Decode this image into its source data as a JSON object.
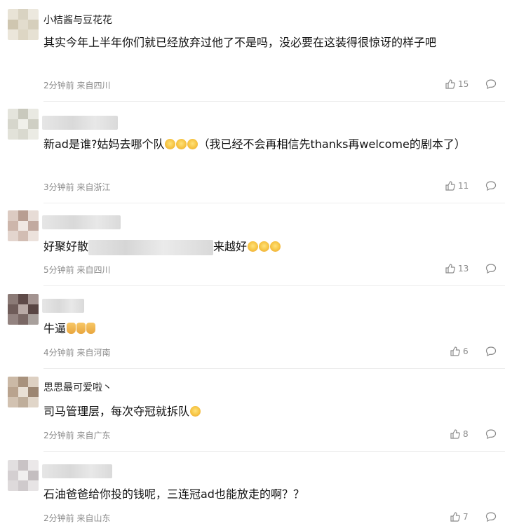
{
  "comments": [
    {
      "username": "小桔酱与豆花花",
      "name_hidden": false,
      "text": "其实今年上半年你们就已经放弃过他了不是吗，没必要在这装得很惊讶的样子吧",
      "meta": "2分钟前 来自四川",
      "likes": "15"
    },
    {
      "username": "",
      "name_hidden": true,
      "text_before": "新ad是谁?姑妈去哪个队",
      "text_after": "（我已经不会再相信先thanks再welcome的剧本了）",
      "meta": "3分钟前 来自浙江",
      "likes": "11"
    },
    {
      "username": "",
      "name_hidden": true,
      "text_before": "好聚好散",
      "text_after": "来越好",
      "meta": "5分钟前 来自四川",
      "likes": "13"
    },
    {
      "username": "",
      "name_hidden": true,
      "text": "牛逼",
      "meta": "4分钟前 来自河南",
      "likes": "6"
    },
    {
      "username": "思思最可爱啦丶",
      "name_hidden": false,
      "text": "司马管理层，每次夺冠就拆队",
      "meta": "2分钟前 来自广东",
      "likes": "8"
    },
    {
      "username": "",
      "name_hidden": true,
      "text": "石油爸爸给你投的钱呢，三连冠ad也能放走的啊？？",
      "meta": "2分钟前 来自山东",
      "likes": "7"
    }
  ],
  "colors": {
    "meta": "#8a8a8a",
    "text": "#111111",
    "divider": "#ececec"
  },
  "icons": {
    "like": "thumbs-up-icon",
    "reply": "comment-bubble-icon"
  }
}
